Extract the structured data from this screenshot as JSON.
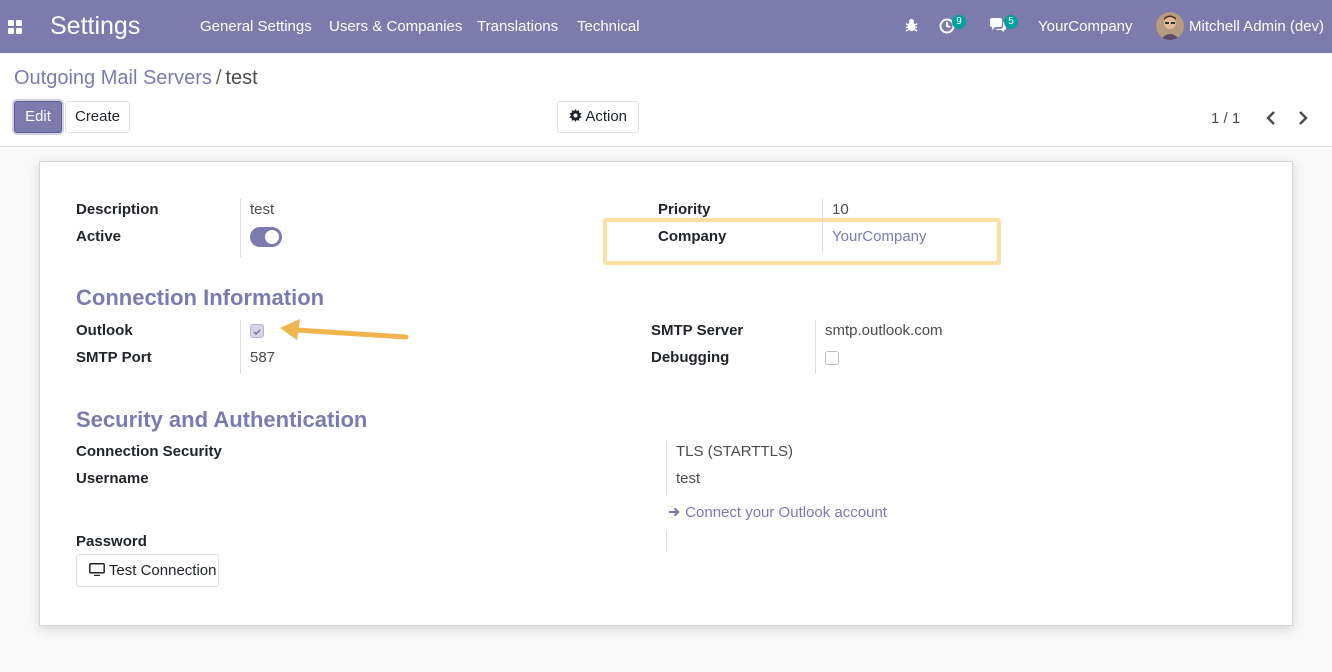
{
  "navbar": {
    "app_title": "Settings",
    "menu": [
      "General Settings",
      "Users & Companies",
      "Translations",
      "Technical"
    ],
    "activity_count": "9",
    "message_count": "5",
    "company": "YourCompany",
    "user": "Mitchell Admin (dev)"
  },
  "breadcrumb": {
    "parent": "Outgoing Mail Servers",
    "separator": "/",
    "current": "test"
  },
  "toolbar": {
    "edit": "Edit",
    "create": "Create",
    "action": "Action"
  },
  "pager": {
    "text": "1 / 1"
  },
  "form": {
    "description_label": "Description",
    "description_value": "test",
    "active_label": "Active",
    "active_value": true,
    "priority_label": "Priority",
    "priority_value": "10",
    "company_label": "Company",
    "company_value": "YourCompany",
    "connection_title": "Connection Information",
    "outlook_label": "Outlook",
    "outlook_checked": true,
    "smtp_port_label": "SMTP Port",
    "smtp_port_value": "587",
    "smtp_server_label": "SMTP Server",
    "smtp_server_value": "smtp.outlook.com",
    "debugging_label": "Debugging",
    "debugging_checked": false,
    "security_title": "Security and Authentication",
    "conn_security_label": "Connection Security",
    "conn_security_value": "TLS (STARTTLS)",
    "username_label": "Username",
    "username_value": "test",
    "connect_outlook": "Connect your Outlook account",
    "password_label": "Password",
    "test_connection": "Test Connection"
  },
  "colors": {
    "brand": "#7c7bad",
    "badge": "#00a09d",
    "highlight": "#fbe0a2",
    "arrow": "#f0b54e"
  }
}
